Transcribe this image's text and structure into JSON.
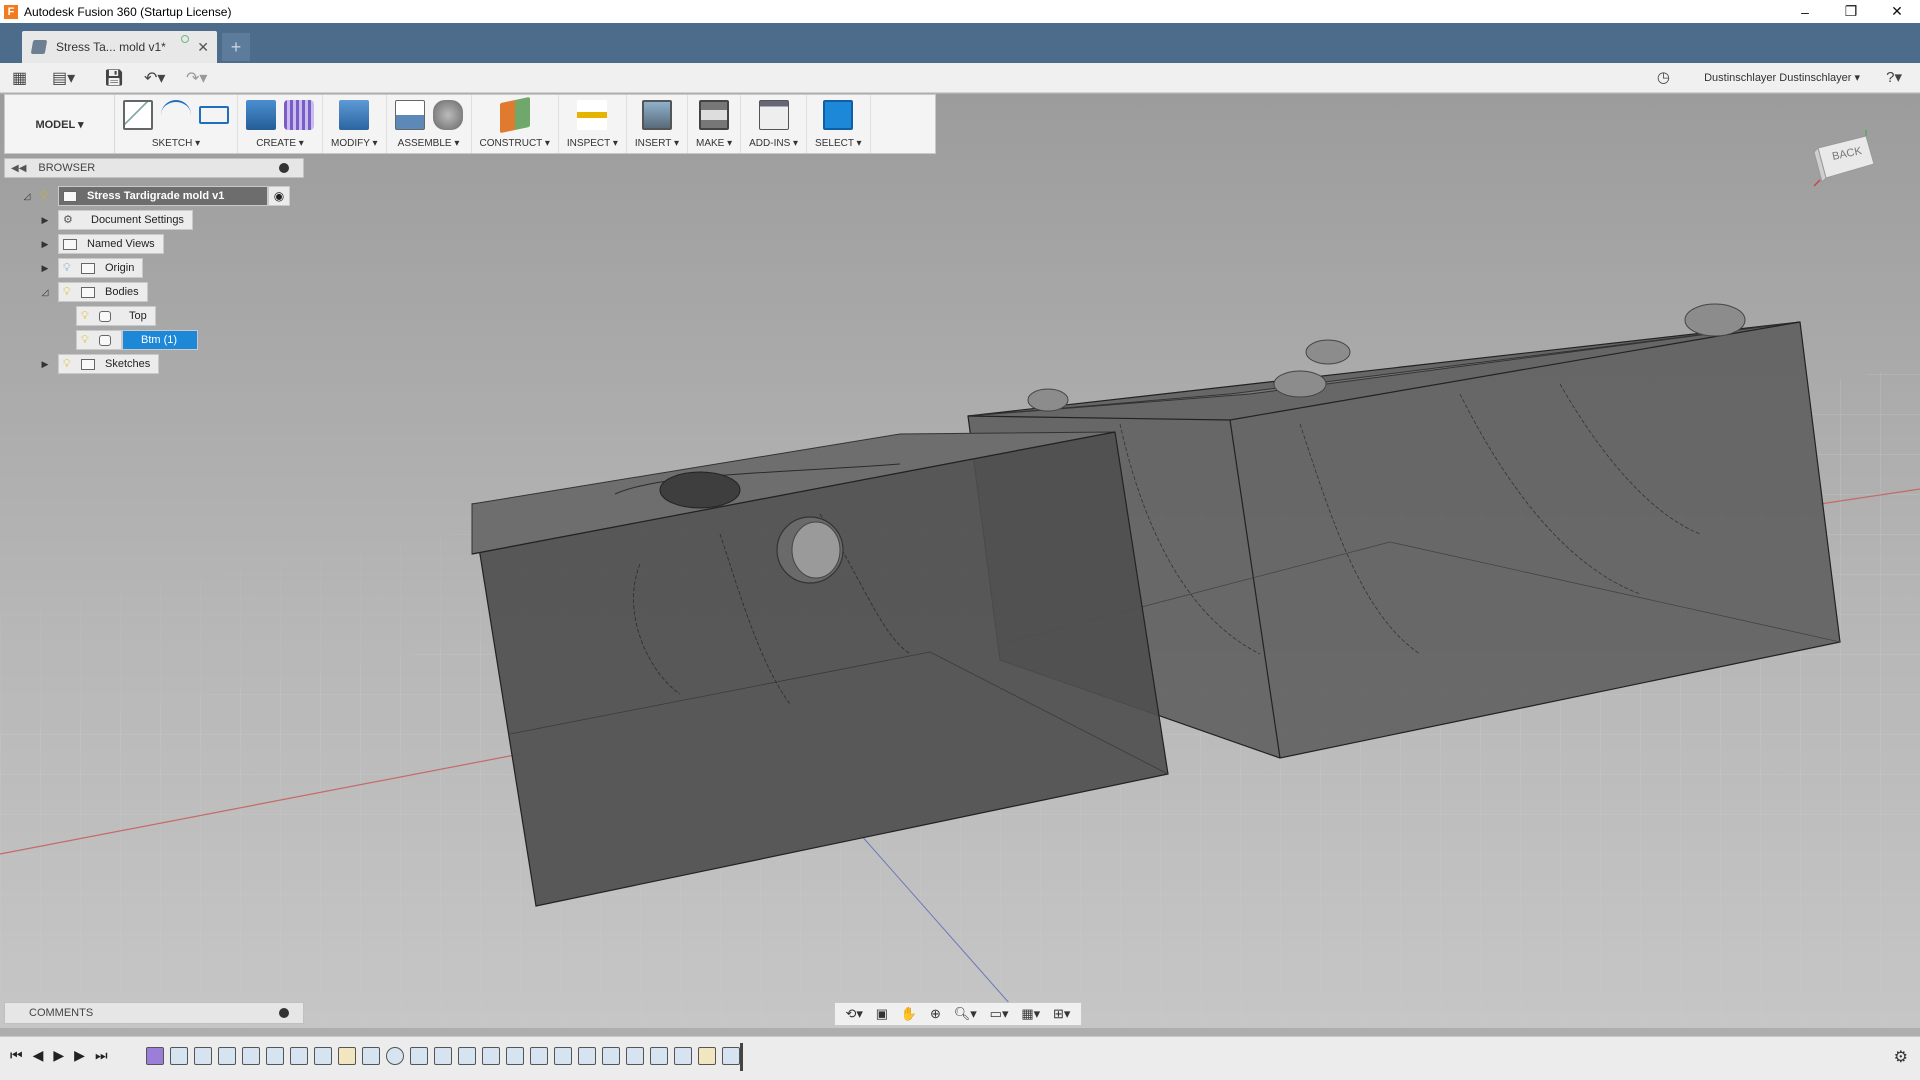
{
  "window": {
    "title": "Autodesk Fusion 360 (Startup License)",
    "app_logo": "F",
    "controls": [
      "–",
      "❐",
      "✕"
    ]
  },
  "tabs": {
    "document_tab": "Stress Ta... mold v1*",
    "new_tab": "+"
  },
  "quick_access": {
    "user": "Dustinschlayer Dustinschlayer ▾",
    "help": "?▾"
  },
  "toolbar": {
    "workspace": "MODEL ▾",
    "groups": [
      {
        "label": "SKETCH ▾",
        "icons": [
          "sketch-create-icon",
          "arc-icon",
          "rectangle-icon"
        ]
      },
      {
        "label": "CREATE ▾",
        "icons": [
          "extrude-icon",
          "form-icon"
        ]
      },
      {
        "label": "MODIFY ▾",
        "icons": [
          "press-pull-icon"
        ]
      },
      {
        "label": "ASSEMBLE ▾",
        "icons": [
          "new-component-icon",
          "joint-icon"
        ]
      },
      {
        "label": "CONSTRUCT ▾",
        "icons": [
          "offset-plane-icon"
        ]
      },
      {
        "label": "INSPECT ▾",
        "icons": [
          "measure-icon"
        ]
      },
      {
        "label": "INSERT ▾",
        "icons": [
          "insert-image-icon"
        ]
      },
      {
        "label": "MAKE ▾",
        "icons": [
          "print-3d-icon"
        ]
      },
      {
        "label": "ADD-INS ▾",
        "icons": [
          "scripts-icon"
        ]
      },
      {
        "label": "SELECT ▾",
        "icons": [
          "select-icon"
        ]
      }
    ]
  },
  "browser": {
    "title": "BROWSER",
    "items": [
      {
        "label": "Stress Tardigrade mold v1",
        "level": 0,
        "expanded": true,
        "root": true
      },
      {
        "label": "Document Settings",
        "level": 1,
        "expanded": false
      },
      {
        "label": "Named Views",
        "level": 1,
        "expanded": false
      },
      {
        "label": "Origin",
        "level": 1,
        "expanded": false
      },
      {
        "label": "Bodies",
        "level": 1,
        "expanded": true
      },
      {
        "label": "Top",
        "level": 2
      },
      {
        "label": "Btm (1)",
        "level": 2,
        "selected": true
      },
      {
        "label": "Sketches",
        "level": 1,
        "expanded": false
      }
    ]
  },
  "comments": {
    "title": "COMMENTS"
  },
  "viewcube": {
    "face": "BACK"
  },
  "colors": {
    "tab_bar": "#4d6b8a",
    "selection": "#1e88d8",
    "viewport_top": "#9c9c9c",
    "viewport_bottom": "#c6c6c6"
  }
}
